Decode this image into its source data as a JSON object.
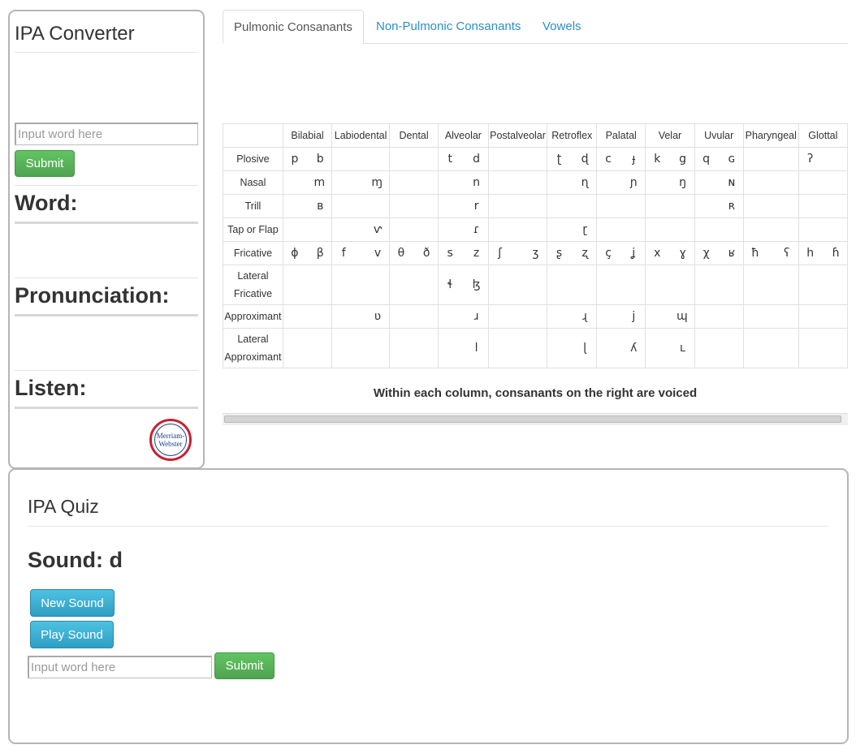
{
  "converter": {
    "title": "IPA Converter",
    "input_placeholder": "Input word here",
    "submit_label": "Submit",
    "word_heading": "Word:",
    "pronunciation_heading": "Pronunciation:",
    "listen_heading": "Listen:",
    "logo_text": [
      "Merriam-",
      "Webster"
    ]
  },
  "tabs": [
    {
      "label": "Pulmonic Consanants",
      "active": true
    },
    {
      "label": "Non-Pulmonic Consanants",
      "active": false
    },
    {
      "label": "Vowels",
      "active": false
    }
  ],
  "table": {
    "columns": [
      "",
      "Bilabial",
      "Labiodental",
      "Dental",
      "Alveolar",
      "Postalveolar",
      "Retroflex",
      "Palatal",
      "Velar",
      "Uvular",
      "Pharyngeal",
      "Glottal"
    ],
    "rows": [
      {
        "label": "Plosive",
        "cells": [
          [
            "p",
            "b"
          ],
          [
            "",
            ""
          ],
          [
            "",
            ""
          ],
          [
            "t",
            "d"
          ],
          [
            "",
            ""
          ],
          [
            "ʈ",
            "ɖ"
          ],
          [
            "c",
            "ɟ"
          ],
          [
            "k",
            "g"
          ],
          [
            "q",
            "ɢ"
          ],
          [
            "",
            ""
          ],
          [
            "ʔ",
            ""
          ]
        ]
      },
      {
        "label": "Nasal",
        "cells": [
          [
            "",
            "m"
          ],
          [
            "",
            "ɱ"
          ],
          [
            "",
            ""
          ],
          [
            "",
            "n"
          ],
          [
            "",
            ""
          ],
          [
            "",
            "ɳ"
          ],
          [
            "",
            "ɲ"
          ],
          [
            "",
            "ŋ"
          ],
          [
            "",
            "ɴ"
          ],
          [
            "",
            ""
          ],
          [
            "",
            ""
          ]
        ]
      },
      {
        "label": "Trill",
        "cells": [
          [
            "",
            "ʙ"
          ],
          [
            "",
            ""
          ],
          [
            "",
            ""
          ],
          [
            "",
            "r"
          ],
          [
            "",
            ""
          ],
          [
            "",
            ""
          ],
          [
            "",
            ""
          ],
          [
            "",
            ""
          ],
          [
            "",
            "ʀ"
          ],
          [
            "",
            ""
          ],
          [
            "",
            ""
          ]
        ]
      },
      {
        "label": "Tap or Flap",
        "cells": [
          [
            "",
            ""
          ],
          [
            "",
            "ⱱ"
          ],
          [
            "",
            ""
          ],
          [
            "",
            "ɾ"
          ],
          [
            "",
            ""
          ],
          [
            "",
            "ɽ"
          ],
          [
            "",
            ""
          ],
          [
            "",
            ""
          ],
          [
            "",
            ""
          ],
          [
            "",
            ""
          ],
          [
            "",
            ""
          ]
        ]
      },
      {
        "label": "Fricative",
        "cells": [
          [
            "ɸ",
            "β"
          ],
          [
            "f",
            "v"
          ],
          [
            "θ",
            "ð"
          ],
          [
            "s",
            "z"
          ],
          [
            "ʃ",
            "ʒ"
          ],
          [
            "ʂ",
            "ʐ"
          ],
          [
            "ç",
            "ʝ"
          ],
          [
            "x",
            "ɣ"
          ],
          [
            "χ",
            "ʁ"
          ],
          [
            "ħ",
            "ʕ"
          ],
          [
            "h",
            "ɦ"
          ]
        ]
      },
      {
        "label": "Lateral Fricative",
        "cells": [
          [
            "",
            ""
          ],
          [
            "",
            ""
          ],
          [
            "",
            ""
          ],
          [
            "ɬ",
            "ɮ"
          ],
          [
            "",
            ""
          ],
          [
            "",
            ""
          ],
          [
            "",
            ""
          ],
          [
            "",
            ""
          ],
          [
            "",
            ""
          ],
          [
            "",
            ""
          ],
          [
            "",
            ""
          ]
        ]
      },
      {
        "label": "Approximant",
        "cells": [
          [
            "",
            ""
          ],
          [
            "",
            "ʋ"
          ],
          [
            "",
            ""
          ],
          [
            "",
            "ɹ"
          ],
          [
            "",
            ""
          ],
          [
            "",
            "ɻ"
          ],
          [
            "",
            "j"
          ],
          [
            "",
            "ɰ"
          ],
          [
            "",
            ""
          ],
          [
            "",
            ""
          ],
          [
            "",
            ""
          ]
        ]
      },
      {
        "label": "Lateral Approximant",
        "cells": [
          [
            "",
            ""
          ],
          [
            "",
            ""
          ],
          [
            "",
            ""
          ],
          [
            "",
            "l"
          ],
          [
            "",
            ""
          ],
          [
            "",
            "ɭ"
          ],
          [
            "",
            "ʎ"
          ],
          [
            "",
            "ʟ"
          ],
          [
            "",
            ""
          ],
          [
            "",
            ""
          ],
          [
            "",
            ""
          ]
        ]
      }
    ],
    "note": "Within each column, consanants on the right are voiced"
  },
  "quiz": {
    "title": "IPA Quiz",
    "sound_label": "Sound: d",
    "new_sound_label": "New Sound",
    "play_sound_label": "Play Sound",
    "input_placeholder": "Input word here",
    "submit_label": "Submit"
  },
  "colors": {
    "green_button": "#5cb85c",
    "blue_button": "#39b3d7",
    "tab_link": "#2a8fc6",
    "panel_border": "#b5b5b5"
  }
}
